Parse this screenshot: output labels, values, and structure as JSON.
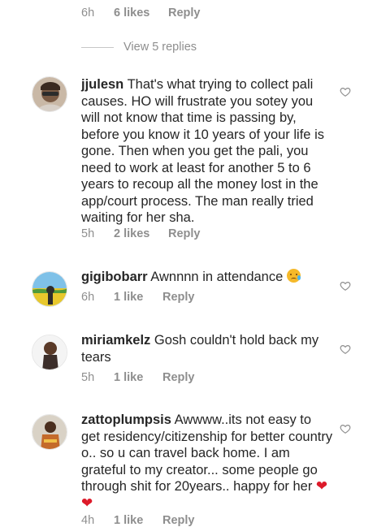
{
  "top_meta": {
    "time": "6h",
    "likes": "6 likes",
    "reply": "Reply"
  },
  "view_replies": "View 5 replies",
  "comments": [
    {
      "username": "jjulesn",
      "text": "That's what trying to collect pali causes. HO will frustrate you sotey you will not know that time is passing by, before you know it 10 years of your life is gone. Then when you get the pali, you need to work at least for another 5 to 6 years to recoup all the money lost in the app/court process. The man really tried waiting for her sha.",
      "time": "5h",
      "likes": "2 likes",
      "reply": "Reply"
    },
    {
      "username": "gigibobarr",
      "text": "Awnnnn in attendance",
      "emoji": "crying-face",
      "time": "6h",
      "likes": "1 like",
      "reply": "Reply"
    },
    {
      "username": "miriamkelz",
      "text": "Gosh couldn't hold back my tears",
      "time": "5h",
      "likes": "1 like",
      "reply": "Reply"
    },
    {
      "username": "zattoplumpsis",
      "text": "Awwww..its not easy to get residency/citizenship for better country o.. so u can travel back home. I am grateful to my creator... some people go through shit for 20years.. happy for her",
      "emoji": "❤❤",
      "time": "4h",
      "likes": "1 like",
      "reply": "Reply"
    }
  ]
}
